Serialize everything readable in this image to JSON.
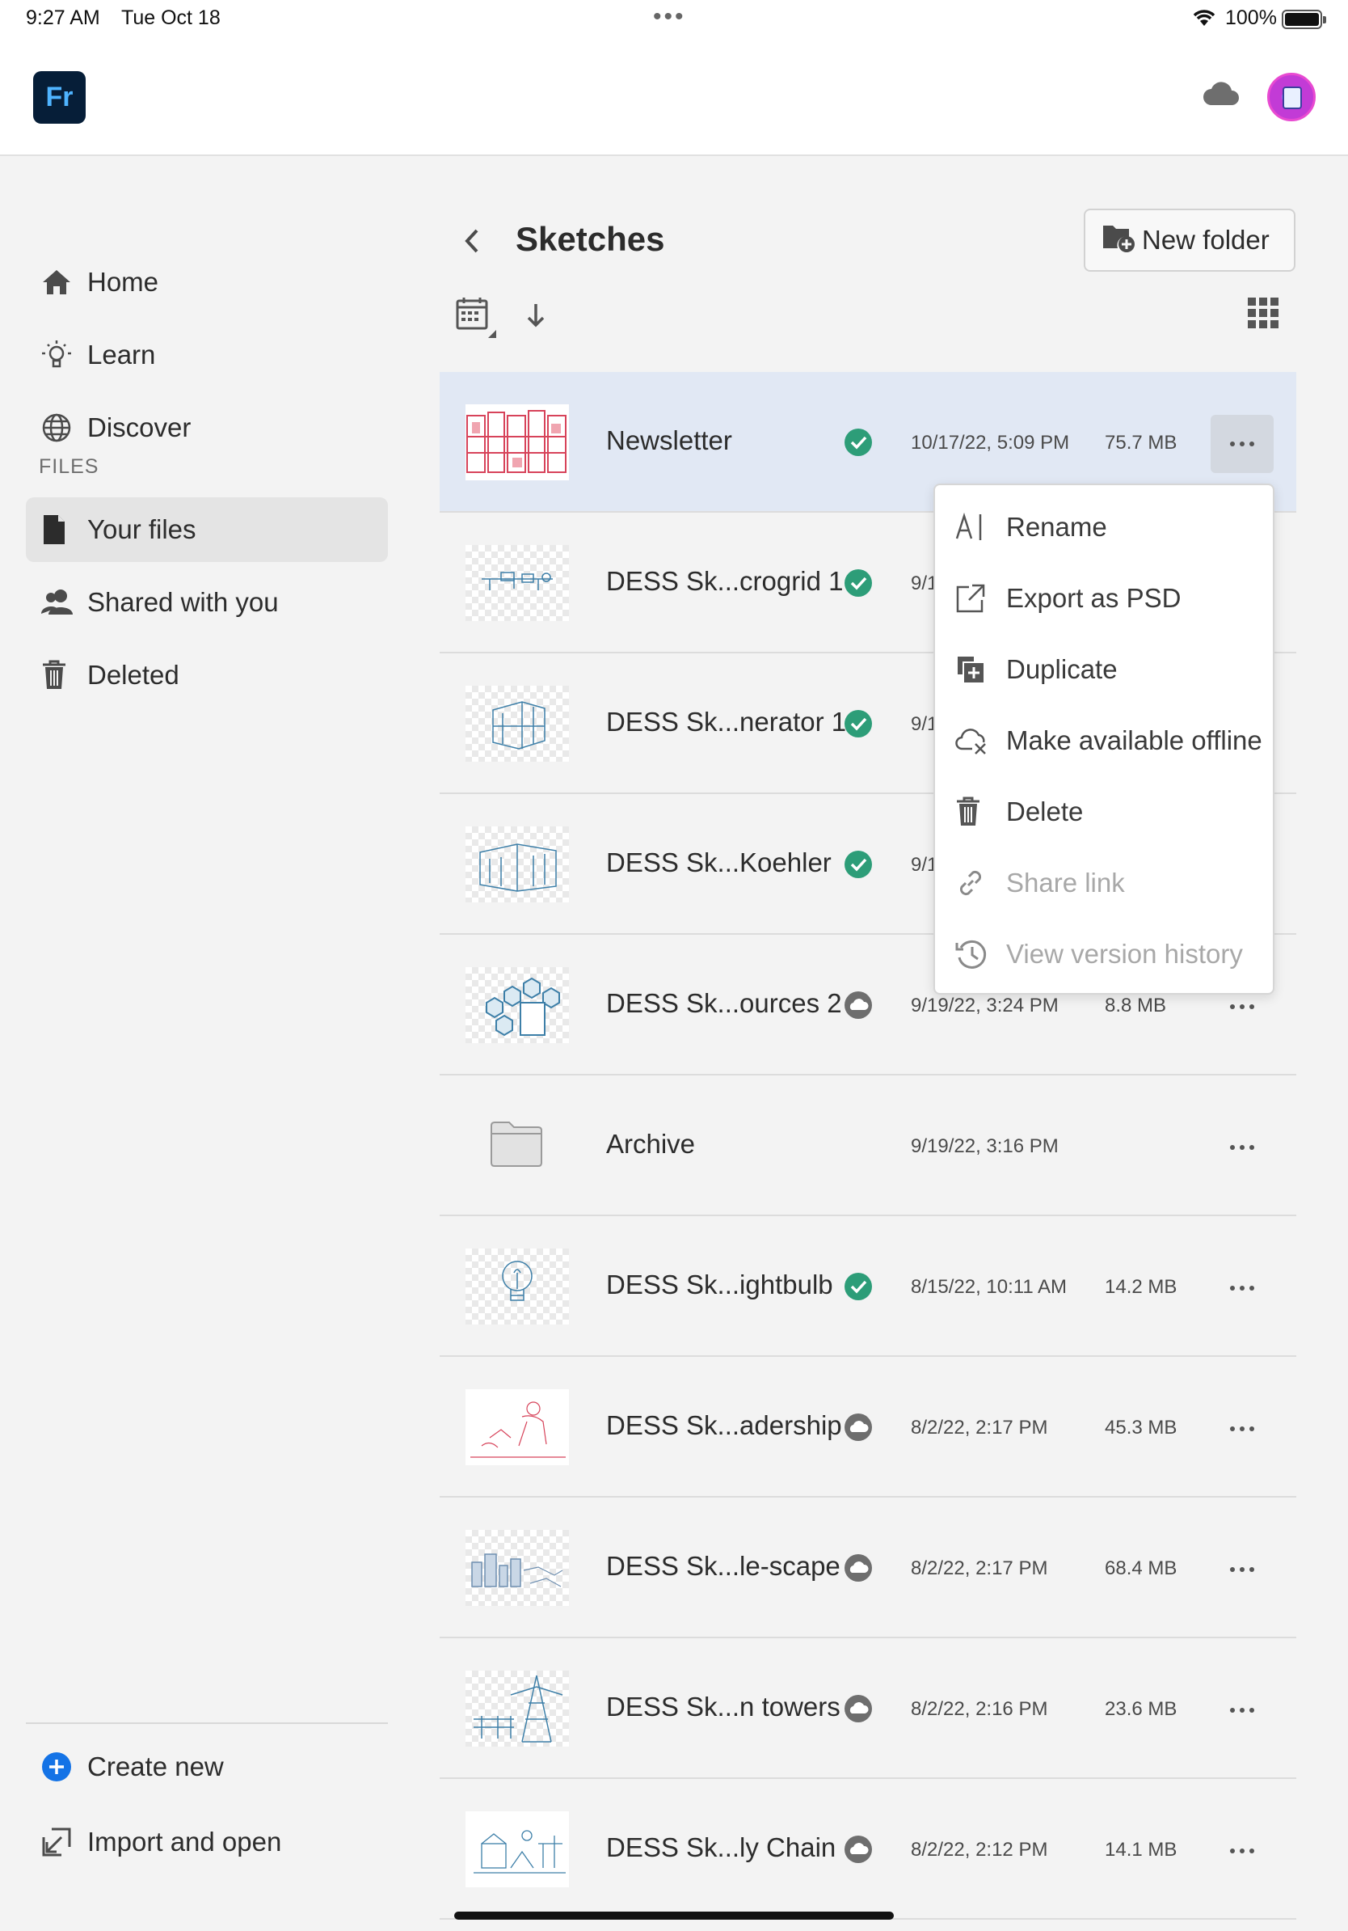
{
  "status_bar": {
    "time": "9:27 AM",
    "date": "Tue Oct 18",
    "battery": "100%"
  },
  "app": {
    "logo_text": "Fr",
    "brand_color": "#061e38",
    "accent_color": "#4fb4ff"
  },
  "sidebar": {
    "items": [
      {
        "label": "Home",
        "icon": "home-icon"
      },
      {
        "label": "Learn",
        "icon": "lightbulb-icon"
      },
      {
        "label": "Discover",
        "icon": "globe-icon"
      }
    ],
    "section_label": "FILES",
    "file_items": [
      {
        "label": "Your files",
        "icon": "file-icon",
        "active": true
      },
      {
        "label": "Shared with you",
        "icon": "users-icon"
      },
      {
        "label": "Deleted",
        "icon": "trash-icon"
      }
    ],
    "bottom_items": [
      {
        "label": "Create new",
        "icon": "plus-circle-icon"
      },
      {
        "label": "Import and open",
        "icon": "import-icon"
      }
    ]
  },
  "main": {
    "title": "Sketches",
    "new_folder_label": "New folder"
  },
  "files": [
    {
      "name": "Newsletter",
      "status": "synced",
      "date": "10/17/22, 5:09 PM",
      "size": "75.7 MB",
      "selected": true
    },
    {
      "name": "DESS Sk...crogrid 1",
      "status": "synced",
      "date": "9/1",
      "size": ""
    },
    {
      "name": "DESS Sk...nerator 1",
      "status": "synced",
      "date": "9/1",
      "size": ""
    },
    {
      "name": "DESS Sk...Koehler",
      "status": "synced",
      "date": "9/1",
      "size": ""
    },
    {
      "name": "DESS Sk...ources 2",
      "status": "cloud",
      "date": "9/19/22, 3:24 PM",
      "size": "8.8 MB"
    },
    {
      "name": "Archive",
      "status": "folder",
      "date": "9/19/22, 3:16 PM",
      "size": ""
    },
    {
      "name": "DESS Sk...ightbulb",
      "status": "synced",
      "date": "8/15/22, 10:11 AM",
      "size": "14.2 MB"
    },
    {
      "name": "DESS Sk...adership",
      "status": "cloud",
      "date": "8/2/22, 2:17 PM",
      "size": "45.3 MB"
    },
    {
      "name": "DESS Sk...le-scape",
      "status": "cloud",
      "date": "8/2/22, 2:17 PM",
      "size": "68.4 MB"
    },
    {
      "name": "DESS Sk...n towers",
      "status": "cloud",
      "date": "8/2/22, 2:16 PM",
      "size": "23.6 MB"
    },
    {
      "name": "DESS Sk...ly Chain",
      "status": "cloud",
      "date": "8/2/22, 2:12 PM",
      "size": "14.1 MB"
    }
  ],
  "context_menu": {
    "items": [
      {
        "label": "Rename",
        "icon": "rename-icon",
        "enabled": true
      },
      {
        "label": "Export as PSD",
        "icon": "export-icon",
        "enabled": true
      },
      {
        "label": "Duplicate",
        "icon": "duplicate-icon",
        "enabled": true
      },
      {
        "label": "Make available offline",
        "icon": "cloud-offline-icon",
        "enabled": true
      },
      {
        "label": "Delete",
        "icon": "trash-icon",
        "enabled": true
      },
      {
        "label": "Share link",
        "icon": "link-icon",
        "enabled": false
      },
      {
        "label": "View version history",
        "icon": "history-icon",
        "enabled": false
      }
    ]
  },
  "colors": {
    "synced_green": "#2d9d78",
    "selected_row": "#e1e8f4",
    "create_new_blue": "#1473e6"
  }
}
